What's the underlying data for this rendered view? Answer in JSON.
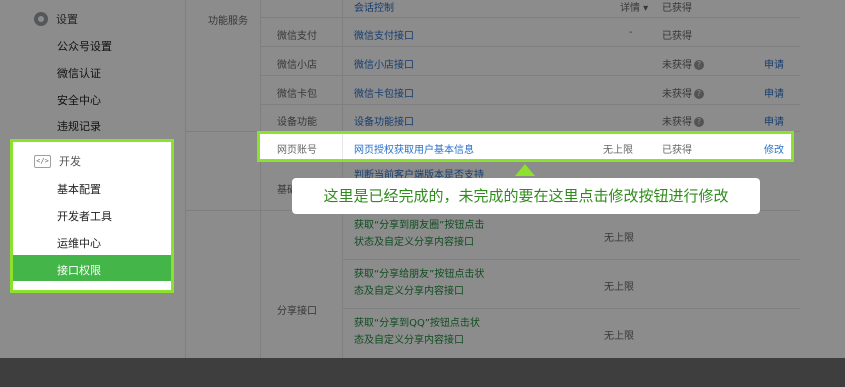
{
  "sidebar": {
    "settings_label": "设置",
    "settings_items": [
      "公众号设置",
      "微信认证",
      "安全中心",
      "违规记录"
    ],
    "dev_label": "开发",
    "dev_items": [
      "基本配置",
      "开发者工具",
      "运维中心"
    ],
    "active_item": "接口权限"
  },
  "table": {
    "group_function": "功能服务",
    "rows": [
      {
        "type": "",
        "name": "会话控制",
        "limit": "详情",
        "status": "已获得",
        "action": ""
      },
      {
        "type": "微信支付",
        "name": "微信支付接口",
        "limit": "-",
        "status": "已获得",
        "action": ""
      },
      {
        "type": "微信小店",
        "name": "微信小店接口",
        "limit": "",
        "status": "未获得",
        "action": "申请"
      },
      {
        "type": "微信卡包",
        "name": "微信卡包接口",
        "limit": "",
        "status": "未获得",
        "action": "申请"
      },
      {
        "type": "设备功能",
        "name": "设备功能接口",
        "limit": "",
        "status": "未获得",
        "action": "申请"
      }
    ],
    "highlight_row": {
      "type": "网页账号",
      "name": "网页授权获取用户基本信息",
      "limit": "无上限",
      "status": "已获得",
      "action": "修改"
    },
    "partial_row_text": "判断当前客户端版本是否支持",
    "partial_group": "基础",
    "share_group": "分享接口",
    "share_rows": [
      {
        "line1": "获取“分享到朋友圈”按钮点击",
        "line2": "状态及自定义分享内容接口",
        "limit": "无上限"
      },
      {
        "line1": "获取“分享给朋友”按钮点击状",
        "line2": "态及自定义分享内容接口",
        "limit": "无上限"
      },
      {
        "line1": "获取“分享到QQ”按钮点击状",
        "line2": "态及自定义分享内容接口",
        "limit": "无上限"
      }
    ]
  },
  "tooltip": "这里是已经完成的，未完成的要在这里点击修改按钮进行修改",
  "colors": {
    "accent_green": "#44b549",
    "highlight_border": "#8be12b",
    "link_blue": "#2a70c9"
  }
}
